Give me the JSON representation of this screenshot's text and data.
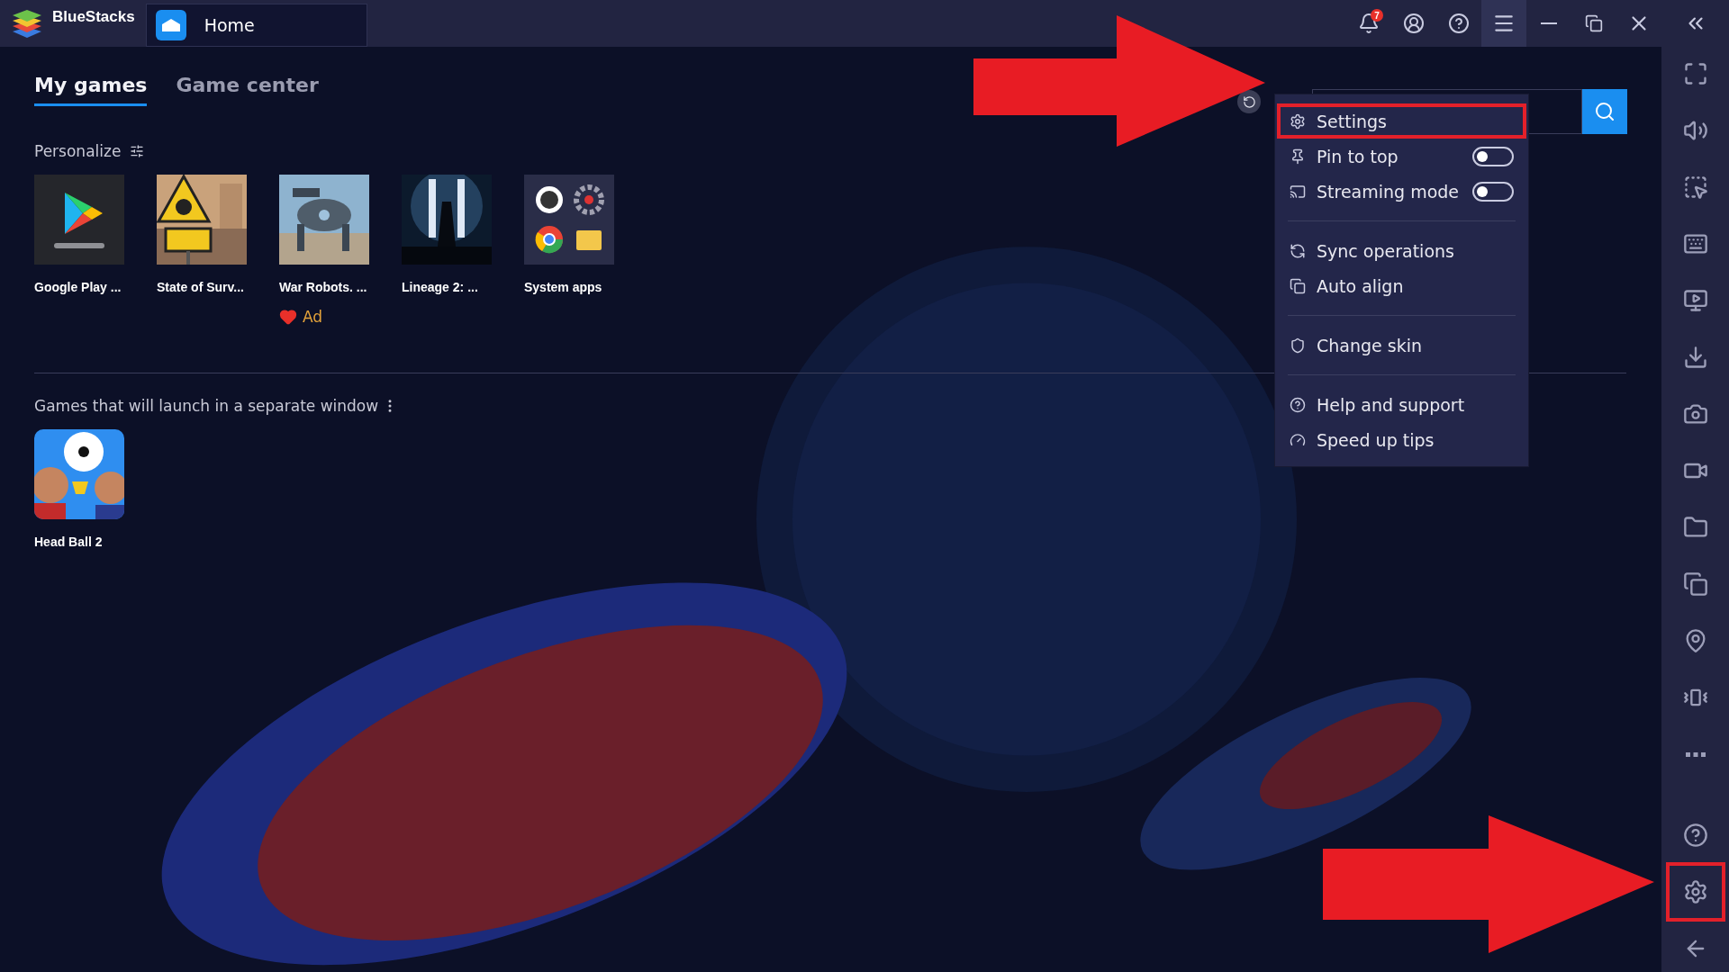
{
  "title_bar": {
    "app_name": "BlueStacks",
    "tab": "Home",
    "notification_count": "7"
  },
  "tabs": [
    {
      "label": "My games",
      "selected": true
    },
    {
      "label": "Game center",
      "selected": false
    }
  ],
  "personalize": {
    "label": "Personalize"
  },
  "games": [
    {
      "name": "Google Play ...",
      "kind": "play"
    },
    {
      "name": "State of Surv...",
      "kind": "sign"
    },
    {
      "name": "War Robots. ...",
      "kind": "robot",
      "ad_label": "Ad"
    },
    {
      "name": "Lineage 2: ...",
      "kind": "dark"
    },
    {
      "name": "System apps",
      "kind": "system"
    }
  ],
  "separate_section": {
    "heading": "Games that will launch in a separate window",
    "games": [
      {
        "name": "Head Ball 2",
        "kind": "ball"
      }
    ]
  },
  "menu": {
    "groups": [
      [
        {
          "label": "Settings",
          "kind": "settings",
          "highlighted": true
        },
        {
          "label": "Pin to top",
          "kind": "pin",
          "toggle": false,
          "highlighted": false
        },
        {
          "label": "Streaming mode",
          "kind": "stream",
          "toggle": false,
          "highlighted": false
        }
      ],
      [
        {
          "label": "Sync operations",
          "kind": "sync",
          "highlighted": false
        },
        {
          "label": "Auto align",
          "kind": "align",
          "highlighted": false
        }
      ],
      [
        {
          "label": "Change skin",
          "kind": "skin",
          "highlighted": false
        }
      ],
      [
        {
          "label": "Help and support",
          "kind": "help",
          "highlighted": false
        },
        {
          "label": "Speed up tips",
          "kind": "speed",
          "highlighted": false
        }
      ]
    ]
  },
  "sidebar": {
    "settings_highlighted": true
  }
}
